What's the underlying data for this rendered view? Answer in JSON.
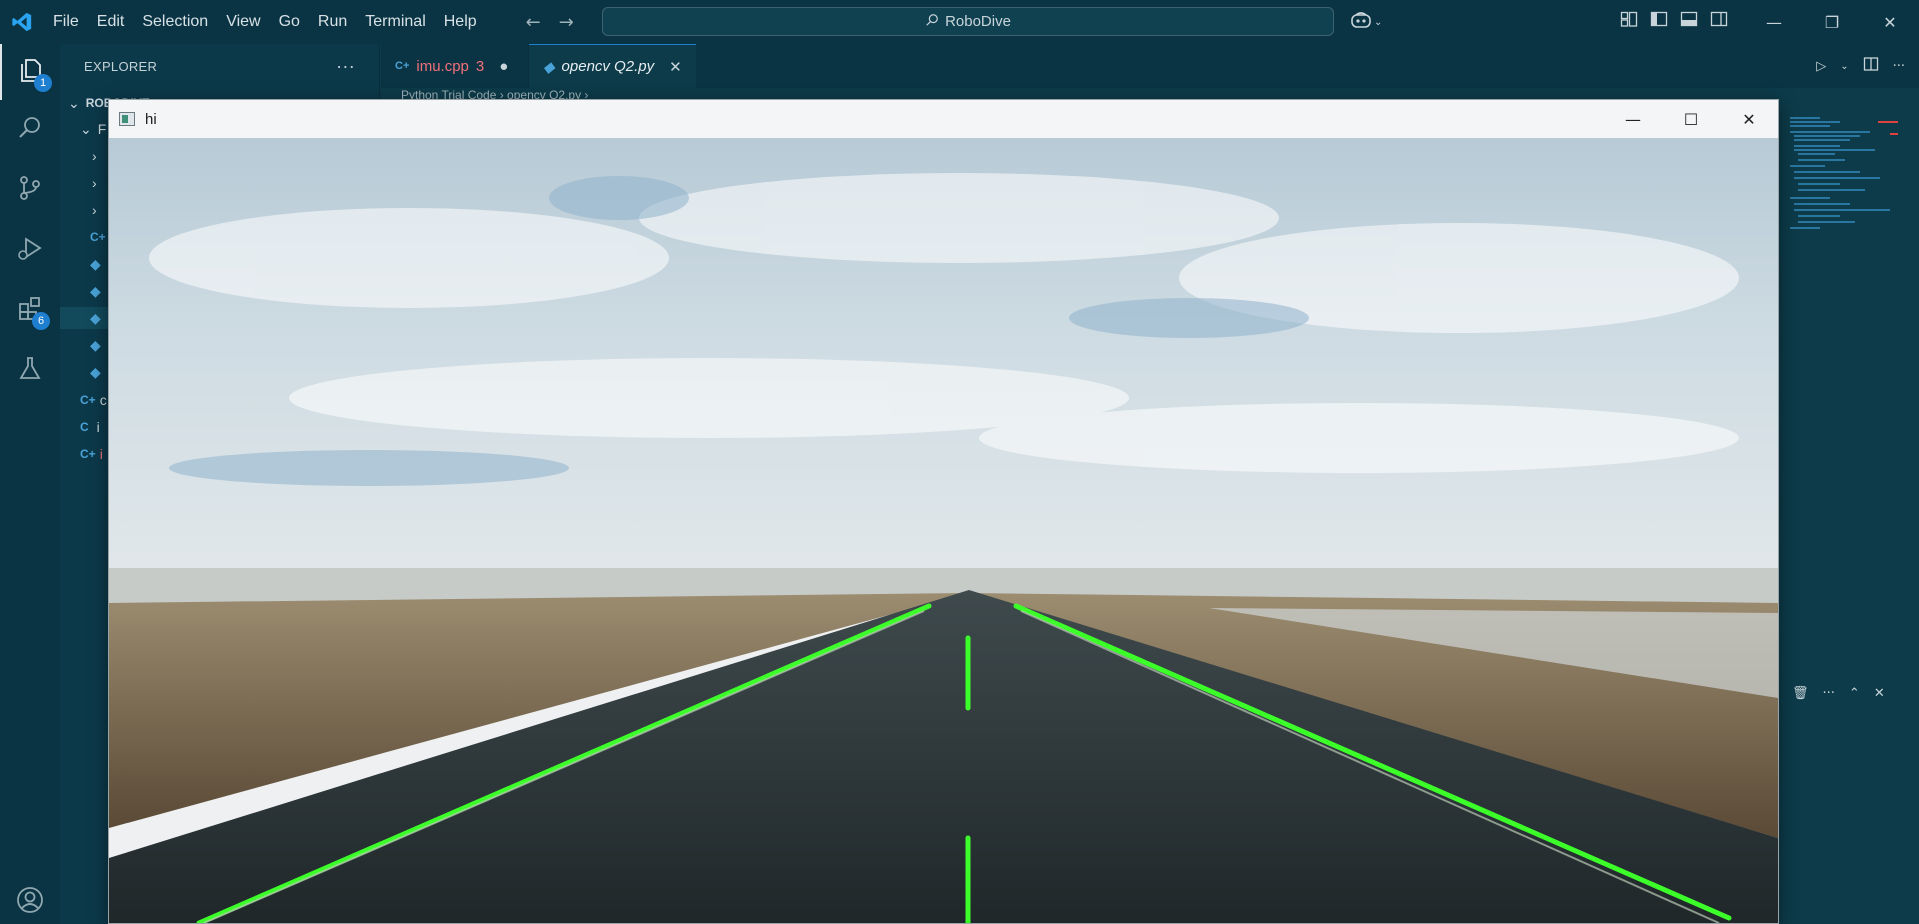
{
  "titlebar": {
    "menu": [
      "File",
      "Edit",
      "Selection",
      "View",
      "Go",
      "Run",
      "Terminal",
      "Help"
    ],
    "search_text": "RoboDive",
    "icons": {
      "logo": "vscode-logo-icon",
      "back": "arrow-left-icon",
      "forward": "arrow-right-icon",
      "search": "search-icon",
      "copilot": "copilot-icon"
    }
  },
  "activity": {
    "items": [
      {
        "name": "explorer",
        "badge": "1"
      },
      {
        "name": "search",
        "badge": ""
      },
      {
        "name": "source-control",
        "badge": ""
      },
      {
        "name": "run-debug",
        "badge": ""
      },
      {
        "name": "extensions",
        "badge": "6"
      },
      {
        "name": "testing",
        "badge": ""
      },
      {
        "name": "accounts",
        "badge": ""
      }
    ]
  },
  "sidebar": {
    "title": "EXPLORER",
    "more": "···",
    "root_label": "ROBODIVE",
    "folder_label": "F",
    "rows_partial": [
      "c",
      "i",
      "i"
    ]
  },
  "tabs": [
    {
      "label": "imu.cpp",
      "problems": "3",
      "modified": true,
      "lang": "cpp",
      "color": "#f0707a"
    },
    {
      "label": "opencv Q2.py",
      "modified": false,
      "lang": "python",
      "color": "#e6edf0"
    }
  ],
  "breadcrumb": "Python Trial Code  ›  opencv Q2.py  ›",
  "cv_window": {
    "title": "hi",
    "buttons": [
      "minimize",
      "maximize",
      "close"
    ]
  },
  "colors": {
    "vscode_bg": "#0d3b4a",
    "accent_blue": "#1e7fd1",
    "lane_green": "#3cff2a",
    "error_red": "#f0707a"
  }
}
